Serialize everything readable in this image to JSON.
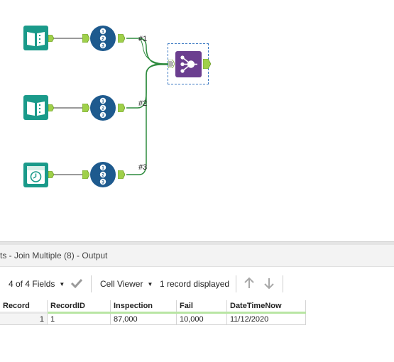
{
  "canvas": {
    "connections": [
      {
        "label": "#1"
      },
      {
        "label": "#2"
      },
      {
        "label": "#3"
      }
    ],
    "tools": [
      {
        "name": "input-data-tool-1",
        "icon": "book-icon",
        "color": "#1a9a8a"
      },
      {
        "name": "input-data-tool-2",
        "icon": "book-icon",
        "color": "#1a9a8a"
      },
      {
        "name": "date-time-now-tool",
        "icon": "clock-icon",
        "color": "#1a9a8a"
      },
      {
        "name": "record-id-tool-1",
        "icon": "numbered-list-icon",
        "color": "#1e5a8e"
      },
      {
        "name": "record-id-tool-2",
        "icon": "numbered-list-icon",
        "color": "#1e5a8e"
      },
      {
        "name": "record-id-tool-3",
        "icon": "numbered-list-icon",
        "color": "#1e5a8e"
      },
      {
        "name": "join-multiple-tool",
        "icon": "join-multiple-icon",
        "color": "#6b3e8f"
      }
    ]
  },
  "results": {
    "title": "ts - Join Multiple (8) - Output",
    "toolbar": {
      "fields_label": "4 of 4 Fields",
      "viewer_label": "Cell Viewer",
      "record_count": "1 record displayed"
    },
    "columns": [
      "Record",
      "RecordID",
      "Inspection",
      "Fail",
      "DateTimeNow"
    ],
    "rows": [
      [
        "1",
        "1",
        "87,000",
        "10,000",
        "11/12/2020"
      ]
    ]
  }
}
